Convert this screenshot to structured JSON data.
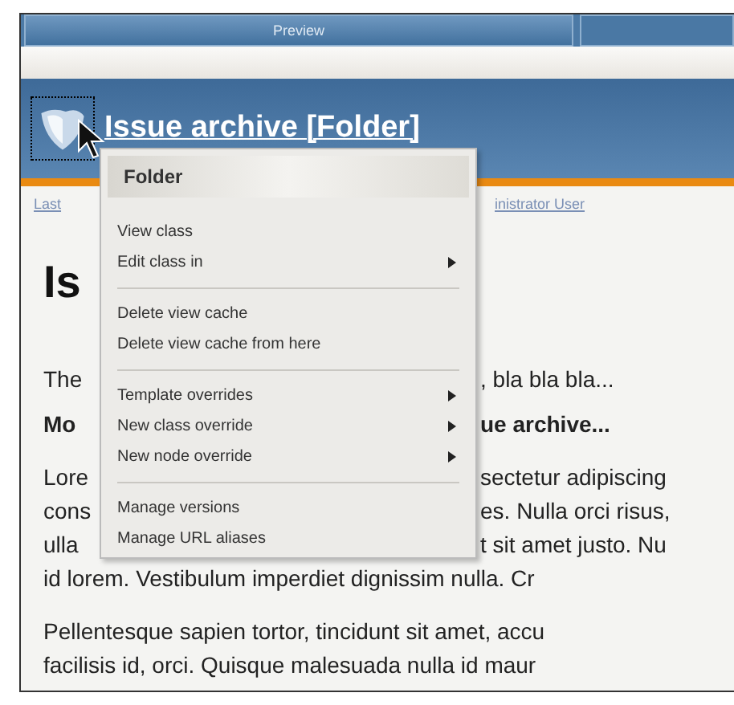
{
  "tabs": [
    {
      "label": "Preview",
      "selected": true
    },
    {
      "selected": false
    }
  ],
  "header": {
    "title": "Issue archive [Folder]"
  },
  "breadcrumb": {
    "left": "Last",
    "right": "inistrator User"
  },
  "content": {
    "heading": "Is",
    "lines": [
      {
        "left": "The",
        "right": ", bla bla bla...",
        "bold": false
      },
      {
        "left": "Mo",
        "right": "ue archive...",
        "bold": true
      }
    ],
    "paragraph_1": [
      {
        "left": "Lore",
        "right": "sectetur adipiscing"
      },
      {
        "left": "cons",
        "right": "es. Nulla orci risus,"
      },
      {
        "left": "ulla",
        "right": "t sit amet justo. Nu"
      },
      {
        "left": "id lorem. Vestibulum imperdiet dignissim nulla. Cr"
      }
    ],
    "paragraph_2": [
      "Pellentesque sapien tortor, tincidunt sit amet, accu",
      "facilisis id, orci. Quisque malesuada nulla id maur"
    ]
  },
  "context_menu": {
    "title": "Folder",
    "sections": [
      [
        {
          "label": "View class",
          "has_submenu": false
        },
        {
          "label": "Edit class in",
          "has_submenu": true
        }
      ],
      [
        {
          "label": "Delete view cache",
          "has_submenu": false
        },
        {
          "label": "Delete view cache from here",
          "has_submenu": false
        }
      ],
      [
        {
          "label": "Template overrides",
          "has_submenu": true
        },
        {
          "label": "New class override",
          "has_submenu": true
        },
        {
          "label": "New node override",
          "has_submenu": true
        }
      ],
      [
        {
          "label": "Manage versions",
          "has_submenu": false
        },
        {
          "label": "Manage URL aliases",
          "has_submenu": false
        }
      ]
    ]
  }
}
